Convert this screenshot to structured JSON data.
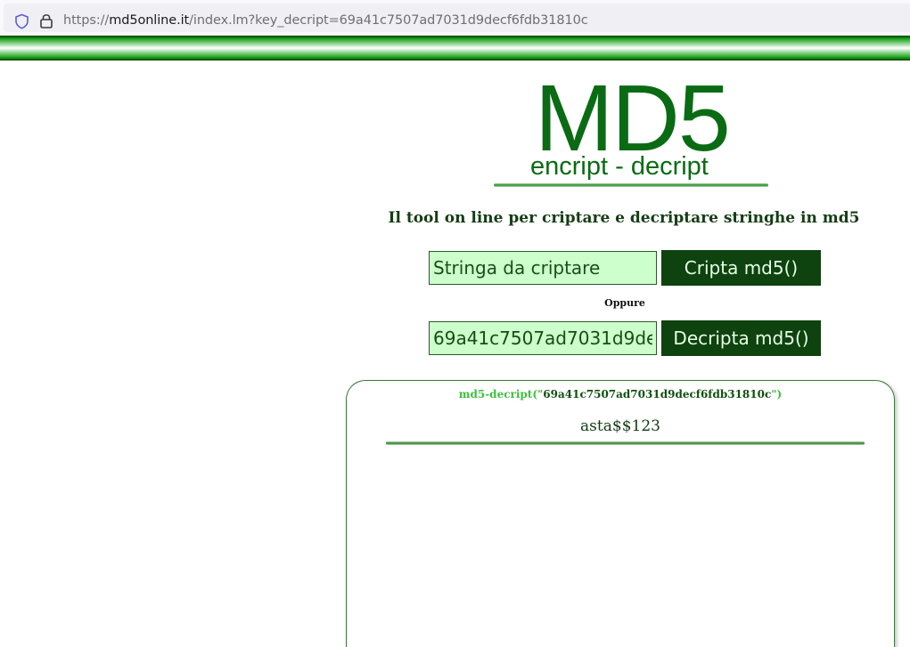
{
  "browser": {
    "url_prefix": "https://",
    "url_host": "md5online.it",
    "url_path": "/index.lm?key_decript=69a41c7507ad7031d9decf6fdb31810c"
  },
  "logo": {
    "main": "MD5",
    "sub": "encript - decript"
  },
  "tagline": "Il tool on line per criptare e decriptare stringhe in md5",
  "encrypt": {
    "placeholder": "Stringa da criptare",
    "button": "Cripta md5()"
  },
  "separator": "Oppure",
  "decrypt": {
    "value": "69a41c7507ad7031d9decf6fdb31810c",
    "button": "Decripta md5()"
  },
  "result": {
    "fn_open": "md5-decript(\"",
    "hash": "69a41c7507ad7031d9decf6fdb31810c",
    "fn_close": "\")",
    "value": "asta$$123"
  },
  "colors": {
    "accent_dark": "#0e420e",
    "input_bg": "#ccffcc",
    "logo_green": "#0a6b14"
  },
  "icons": {
    "shield": "shield-icon",
    "lock": "lock-icon"
  }
}
